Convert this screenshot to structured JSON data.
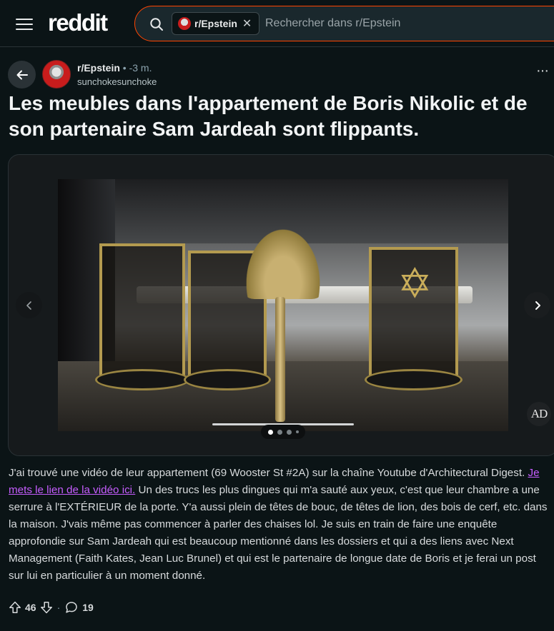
{
  "header": {
    "logo_text": "reddit",
    "search": {
      "chip_label": "r/Epstein",
      "placeholder": "Rechercher dans r/Epstein"
    }
  },
  "post": {
    "subreddit": "r/Epstein",
    "separator": "•",
    "age": "-3 m.",
    "author": "sunchokesunchoke",
    "title": "Les meubles dans l'appartement de Boris Nikolic et de son partenaire Sam Jardeah sont flippants.",
    "media": {
      "watermark": "AD",
      "slide_count": 4,
      "active_slide": 1
    },
    "body": {
      "part1": "J'ai trouvé une vidéo de leur appartement (69 Wooster St #2A) sur la chaîne Youtube d'Architectural Digest. ",
      "link": "Je mets le lien de la vidéo ici.",
      "part2": " Un des trucs les plus dingues qui m'a sauté aux yeux, c'est que leur chambre a une serrure à l'EXTÉRIEUR de la porte. Y'a aussi plein de têtes de bouc, de têtes de lion, des bois de cerf, etc. dans la maison. J'vais même pas commencer à parler des chaises lol. Je suis en train de faire une enquête approfondie sur Sam Jardeah qui est beaucoup mentionné dans les dossiers et qui a des liens avec Next Management (Faith Kates, Jean Luc Brunel) et qui est le partenaire de longue date de Boris et je ferai un post sur lui en particulier à un moment donné."
    },
    "actions": {
      "score": "46",
      "separator": "·",
      "comments": "19"
    }
  },
  "icons": [
    "menu-icon",
    "search-icon",
    "close-icon",
    "back-arrow-icon",
    "more-icon",
    "chevron-left-icon",
    "chevron-right-icon",
    "upvote-icon",
    "downvote-icon",
    "comment-icon"
  ],
  "colors": {
    "background": "#0b1416",
    "accent": "#ff4500",
    "link": "#c65dff"
  }
}
